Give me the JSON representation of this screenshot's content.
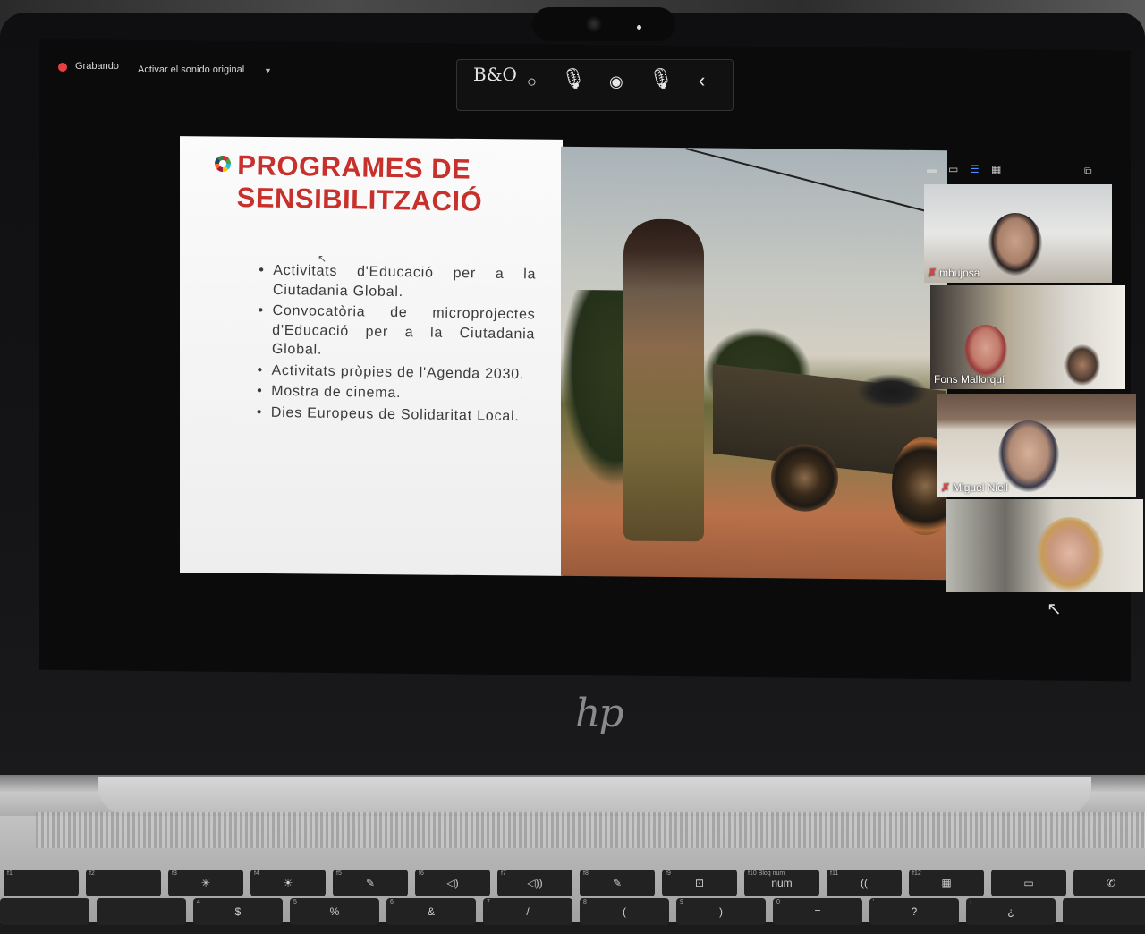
{
  "meeting": {
    "recording_label": "Grabando",
    "original_sound_label": "Activar el sonido original"
  },
  "toolbar": {
    "brand_label": "B&O"
  },
  "slide": {
    "title_line1": "PROGRAMES DE",
    "title_line2": "SENSIBILITZACIÓ",
    "bullets": [
      "Activitats d'Educació per a la Ciutadania Global.",
      "Convocatòria de microprojectes d'Educació per a la Ciutadania Global.",
      "Activitats pròpies de l'Agenda 2030.",
      "Mostra de cinema.",
      "Dies Europeus de Solidaritat Local."
    ],
    "title_color": "#c8302b"
  },
  "participants": [
    {
      "name": "mbujosa",
      "muted": true
    },
    {
      "name": "Fons Mallorquí",
      "muted": false
    },
    {
      "name": "Miguel Niell",
      "muted": true
    },
    {
      "name": "",
      "muted": false
    }
  ],
  "laptop": {
    "logo": "hp"
  },
  "keyboard": {
    "fn_row": [
      "",
      "",
      "✳",
      "☀",
      "✎",
      "◁)",
      "◁))",
      "✎",
      "⊡",
      "num",
      "((",
      "▦",
      "▭",
      "✆"
    ],
    "fn_row_sub": [
      "f1",
      "f2",
      "f3",
      "f4",
      "f5",
      "f6",
      "f7",
      "f8",
      "f9",
      "f10 Bloq num",
      "f11",
      "f12",
      "",
      ""
    ],
    "num_row": [
      "",
      "",
      "$",
      "%",
      "&",
      "/",
      "(",
      ")",
      "=",
      "?",
      "¿",
      ""
    ],
    "num_row_sub": [
      "",
      "",
      "4",
      "5",
      "6",
      "7",
      "8",
      "9",
      "0",
      "'",
      "¡",
      ""
    ]
  }
}
